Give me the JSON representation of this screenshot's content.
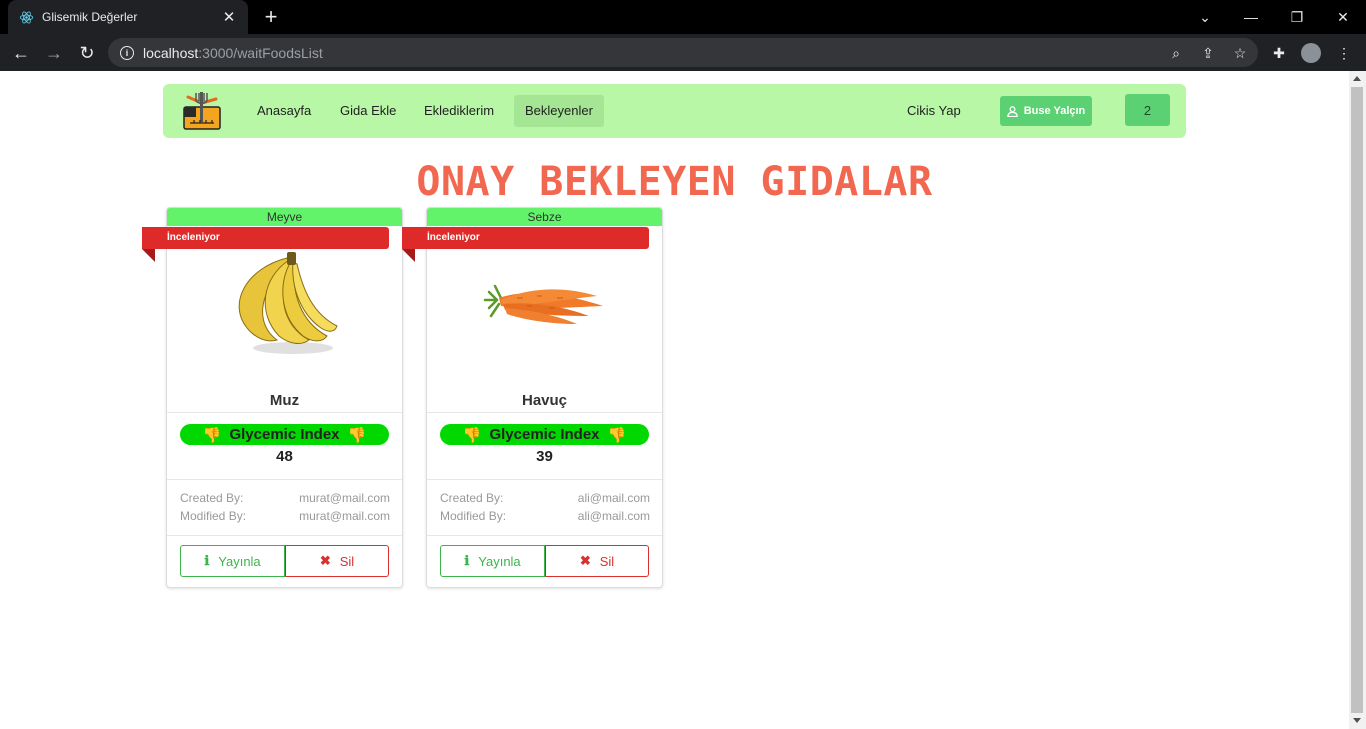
{
  "browser": {
    "tab_title": "Glisemik Değerler",
    "url_host": "localhost",
    "url_path": ":3000/waitFoodsList"
  },
  "navbar": {
    "links": [
      "Anasayfa",
      "Gida Ekle",
      "Eklediklerim",
      "Bekleyenler"
    ],
    "active": "Bekleyenler",
    "logout": "Cikis Yap",
    "user": "Buse Yalçın",
    "count": "2"
  },
  "page_title": "ONAY BEKLEYEN GIDALAR",
  "cards": [
    {
      "category": "Meyve",
      "status": "İnceleniyor",
      "name": "Muz",
      "gi_label": "Glycemic Index",
      "gi_value": "48",
      "created_label": "Created By:",
      "created_by": "murat@mail.com",
      "modified_label": "Modified By:",
      "modified_by": "murat@mail.com",
      "publish": "Yayınla",
      "delete": "Sil"
    },
    {
      "category": "Sebze",
      "status": "İnceleniyor",
      "name": "Havuç",
      "gi_label": "Glycemic Index",
      "gi_value": "39",
      "created_label": "Created By:",
      "created_by": "ali@mail.com",
      "modified_label": "Modified By:",
      "modified_by": "ali@mail.com",
      "publish": "Yayınla",
      "delete": "Sil"
    }
  ],
  "colors": {
    "navbar_bg": "#b7f7a6",
    "title": "#f26750",
    "category_bar": "#62f36a",
    "ribbon": "#df2a2a",
    "gi_pill": "#00d800",
    "publish": "#3cb44b",
    "delete": "#d93030"
  },
  "icons": {
    "tab": "react-icon",
    "user": "user-icon",
    "gi": "thumbs-down-icon",
    "publish": "info-icon",
    "delete": "times-icon"
  }
}
